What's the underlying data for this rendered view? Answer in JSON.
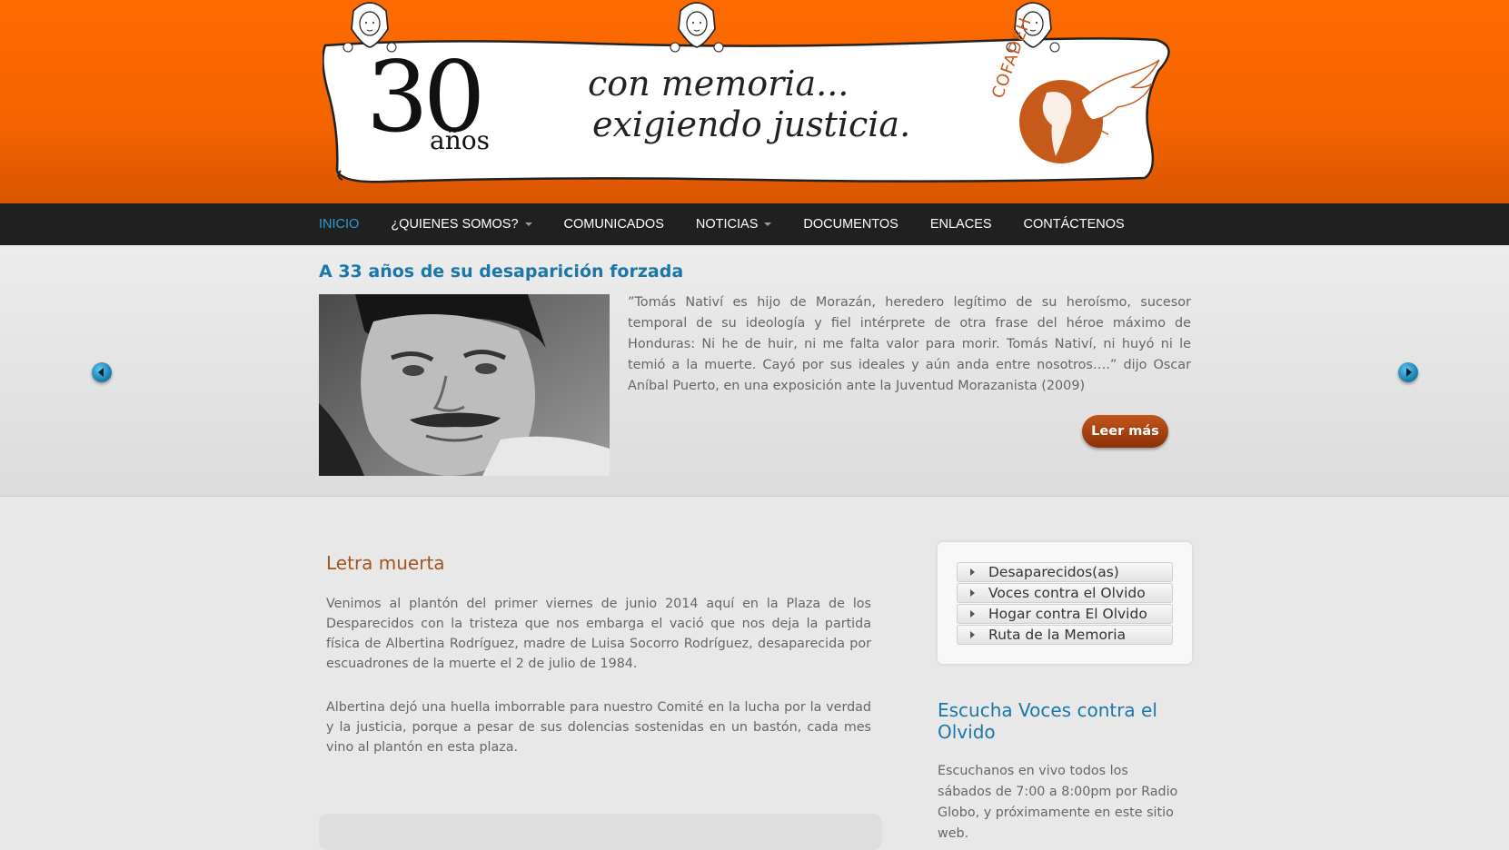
{
  "banner": {
    "number": "30",
    "years": "años",
    "slogan_line1": "con memoria...",
    "slogan_line2": "exigiendo justicia.",
    "logo_text": "COFADEH"
  },
  "nav": {
    "items": [
      {
        "label": "INICIO",
        "active": true,
        "dropdown": false
      },
      {
        "label": "¿QUIENES SOMOS?",
        "active": false,
        "dropdown": true
      },
      {
        "label": "COMUNICADOS",
        "active": false,
        "dropdown": false
      },
      {
        "label": "NOTICIAS",
        "active": false,
        "dropdown": true
      },
      {
        "label": "DOCUMENTOS",
        "active": false,
        "dropdown": false
      },
      {
        "label": "ENLACES",
        "active": false,
        "dropdown": false
      },
      {
        "label": "CONTÁCTENOS",
        "active": false,
        "dropdown": false
      }
    ]
  },
  "slider": {
    "title": "A 33 años de su desaparición forzada",
    "text": "”Tomás Nativí es hijo de Morazán, heredero legítimo de su heroísmo, sucesor temporal de su ideología y fiel intérprete de otra frase del héroe máximo de Honduras: Ni he de huir, ni me falta valor para morir. Tomás Nativí, ni huyó ni le temió a la muerte. Cayó por sus ideales y aún anda entre nosotros….” dijo Oscar Aníbal Puerto, en una exposición ante la Juventud Morazanista (2009)",
    "button": "Leer más"
  },
  "article": {
    "title": "Letra muerta",
    "paragraphs": [
      "Venimos al plantón del primer viernes de junio 2014 aquí en la Plaza de los Desparecidos con la tristeza que nos embarga el vació que nos deja la partida física de Albertina Rodríguez, madre de Luisa Socorro Rodríguez, desaparecida por escuadrones de la muerte el 2 de julio de 1984.",
      "Albertina dejó una huella imborrable para nuestro Comité en la lucha por la verdad y la justicia, porque a pesar de sus dolencias sostenidas en un bastón, cada mes vino al plantón en esta plaza."
    ]
  },
  "sidebar": {
    "menu": [
      "Desaparecidos(as)",
      "Voces contra el Olvido",
      "Hogar contra El Olvido",
      "Ruta de la Memoria"
    ],
    "radio_title": "Escucha Voces contra el Olvido",
    "radio_text": "Escuchanos en vivo todos los sábados de 7:00 a 8:00pm por Radio Globo, y próximamente en este sitio web."
  },
  "colors": {
    "header_orange": "#f56400",
    "nav_bg": "#202020",
    "active_link": "#2a9ed8",
    "title_blue": "#1a77aa",
    "article_title": "#a3531c",
    "button_brown": "#8a3208"
  },
  "icons": [
    "prev-arrow-icon",
    "next-arrow-icon",
    "dove-icon",
    "map-icon",
    "caret-down-icon"
  ]
}
